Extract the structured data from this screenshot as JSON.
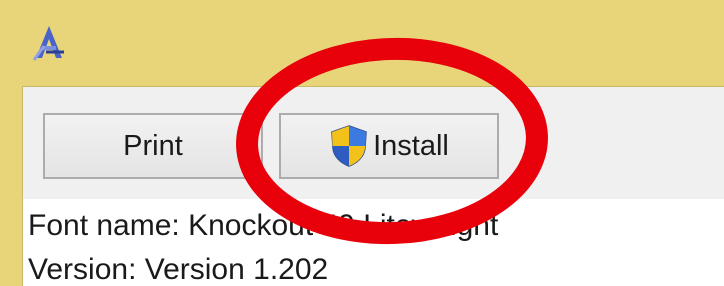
{
  "toolbar": {
    "print_label": "Print",
    "install_label": "Install"
  },
  "info": {
    "font_name_line": "Font name: Knockout 49 Liteweight",
    "version_line": "Version: Version 1.202"
  },
  "colors": {
    "title_bar": "#e8d57a",
    "highlight_circle": "#e8000b"
  },
  "icons": [
    "font-viewer-app-icon",
    "uac-shield-icon"
  ]
}
